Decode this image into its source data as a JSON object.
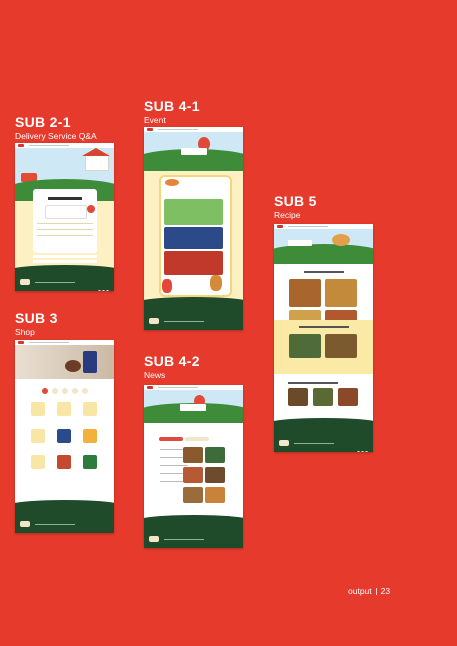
{
  "sections": {
    "sub2_1": {
      "title": "SUB 2-1",
      "subtitle": "Delivery Service Q&A"
    },
    "sub3": {
      "title": "SUB 3",
      "subtitle": "Shop"
    },
    "sub4_1": {
      "title": "SUB 4-1",
      "subtitle": "Event"
    },
    "sub4_2": {
      "title": "SUB 4-2",
      "subtitle": "News"
    },
    "sub5": {
      "title": "SUB 5",
      "subtitle": "Recipe"
    }
  },
  "footer": {
    "label": "output",
    "page": "23"
  },
  "colors": {
    "background": "#e53a2c",
    "green": "#1f4b2a",
    "cream": "#fbe9a6",
    "sky": "#cfe8f6"
  }
}
